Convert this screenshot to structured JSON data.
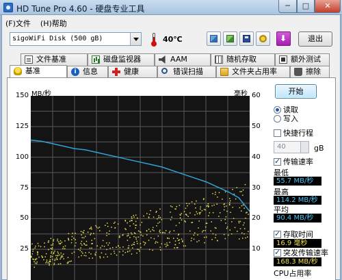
{
  "window": {
    "title": "HD Tune Pro 4.60 - 硬盘专业工具",
    "min_glyph": "─",
    "max_glyph": "□",
    "close_glyph": "✕"
  },
  "menu": {
    "file": "(F)文件",
    "help": "(H)帮助"
  },
  "toolbar": {
    "drive": "sigoWiFi Disk (500 gB)",
    "temperature": "40℃",
    "exit_label": "退出"
  },
  "tabs_top": [
    {
      "label": "文件基准",
      "icon": "document-icon"
    },
    {
      "label": "磁盘监视器",
      "icon": "chart-icon"
    },
    {
      "label": "AAM",
      "icon": "speaker-icon"
    },
    {
      "label": "随机存取",
      "icon": "grid-icon"
    },
    {
      "label": "额外测试",
      "icon": "erase-icon"
    }
  ],
  "tabs_bottom": [
    {
      "label": "基准",
      "icon": "bulb-icon"
    },
    {
      "label": "信息",
      "icon": "info-icon"
    },
    {
      "label": "健康",
      "icon": "plus-icon"
    },
    {
      "label": "错误扫描",
      "icon": "search-icon"
    },
    {
      "label": "文件夹占用率",
      "icon": "folder-icon"
    },
    {
      "label": "擦除",
      "icon": "trash-icon"
    }
  ],
  "colors": {
    "transfer_line": "#2fa4d8",
    "access_dots": "#e8e04a",
    "plot_bg": "#141414",
    "grid": "#5a5a5a"
  },
  "chart_data": {
    "type": "line",
    "left_axis_unit": "MB/秒",
    "right_axis_unit": "毫秒",
    "left_ticks": [
      "150",
      "125",
      "100",
      "75",
      "50",
      "25",
      "0"
    ],
    "right_ticks": [
      "60",
      "50",
      "40",
      "30",
      "20",
      "10",
      "0"
    ],
    "ylim_left": [
      0,
      150
    ],
    "ylim_right": [
      0,
      60
    ],
    "xlim": [
      0,
      100
    ],
    "series": [
      {
        "axis": "left",
        "x": [
          0,
          5,
          10,
          15,
          20,
          25,
          30,
          35,
          40,
          45,
          50,
          55,
          60,
          65,
          70,
          75,
          80,
          85,
          90,
          95,
          100
        ],
        "values": [
          114,
          113,
          111,
          109,
          107,
          106,
          104,
          102,
          100,
          98,
          96,
          94,
          92,
          89,
          86,
          83,
          80,
          76,
          72,
          67,
          56
        ]
      }
    ],
    "scatter_band": {
      "axis": "right",
      "start_range": [
        4,
        12
      ],
      "end_range": [
        14,
        32
      ]
    }
  },
  "right_panel": {
    "start_label": "开始",
    "read_label": "读取",
    "write_label": "写入",
    "quick_label": "快捷行程",
    "quick_value": "40",
    "quick_unit": "gB",
    "transfer_label": "传输速率",
    "min_label": "最低",
    "min_value": "55.7 MB/秒",
    "max_label": "最高",
    "max_value": "114.2 MB/秒",
    "avg_label": "平均",
    "avg_value": "90.4 MB/秒",
    "access_label": "存取时间",
    "access_value": "16.9 毫秒",
    "burst_label": "突发传输速率",
    "burst_value": "168.3 MB/秒",
    "cpu_label": "CPU占用率"
  }
}
